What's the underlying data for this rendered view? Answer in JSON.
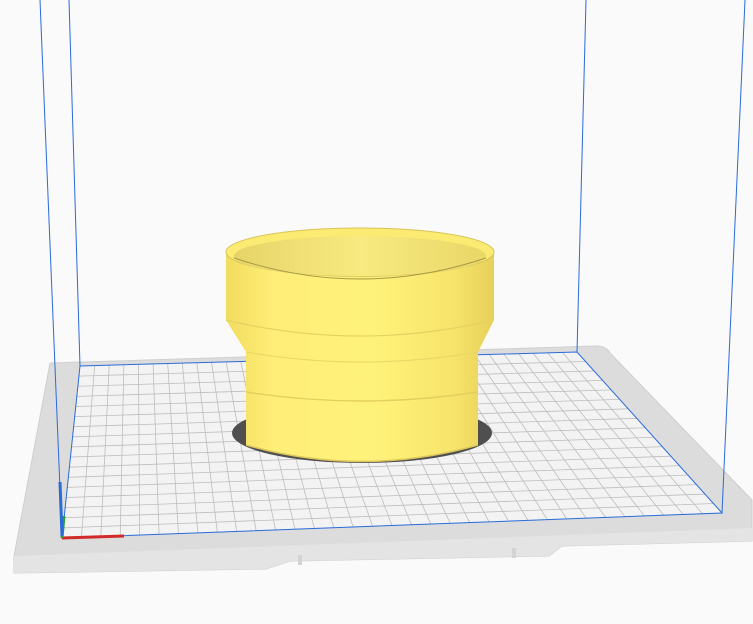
{
  "scene": {
    "view": "3d-print-preview",
    "background_color": "#fafafa",
    "build_volume_color": "#2a6bd8",
    "bed_color": "#d9d9d9",
    "bed_edge_color": "#c7c7c7",
    "grid_fill_color": "#f3f3f3",
    "grid_line_color": "#b9b9b9",
    "model_color": "#ffee70",
    "model_shadow_color": "#4f4f4f",
    "axis_x_color": "#d22a2a",
    "axis_y_color": "#2a9d3a",
    "axis_z_color": "#2a6bd8",
    "model": {
      "name": "model",
      "shape": "stepped-cup",
      "selected": false
    }
  }
}
